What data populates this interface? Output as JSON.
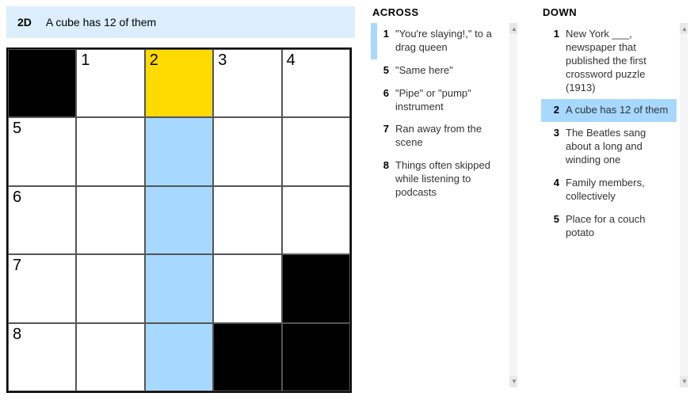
{
  "clue_bar": {
    "number": "2D",
    "text": "A cube has 12 of them"
  },
  "grid": {
    "rows": 5,
    "cols": 5,
    "cells": [
      {
        "r": 0,
        "c": 0,
        "black": true
      },
      {
        "r": 0,
        "c": 1,
        "num": "1"
      },
      {
        "r": 0,
        "c": 2,
        "num": "2",
        "selected": true
      },
      {
        "r": 0,
        "c": 3,
        "num": "3"
      },
      {
        "r": 0,
        "c": 4,
        "num": "4"
      },
      {
        "r": 1,
        "c": 0,
        "num": "5"
      },
      {
        "r": 1,
        "c": 1
      },
      {
        "r": 1,
        "c": 2,
        "highlight": true
      },
      {
        "r": 1,
        "c": 3
      },
      {
        "r": 1,
        "c": 4
      },
      {
        "r": 2,
        "c": 0,
        "num": "6"
      },
      {
        "r": 2,
        "c": 1
      },
      {
        "r": 2,
        "c": 2,
        "highlight": true
      },
      {
        "r": 2,
        "c": 3
      },
      {
        "r": 2,
        "c": 4
      },
      {
        "r": 3,
        "c": 0,
        "num": "7"
      },
      {
        "r": 3,
        "c": 1
      },
      {
        "r": 3,
        "c": 2,
        "highlight": true
      },
      {
        "r": 3,
        "c": 3
      },
      {
        "r": 3,
        "c": 4,
        "black": true
      },
      {
        "r": 4,
        "c": 0,
        "num": "8"
      },
      {
        "r": 4,
        "c": 1
      },
      {
        "r": 4,
        "c": 2,
        "highlight": true
      },
      {
        "r": 4,
        "c": 3,
        "black": true
      },
      {
        "r": 4,
        "c": 4,
        "black": true
      }
    ]
  },
  "across": {
    "heading": "ACROSS",
    "clues": [
      {
        "num": "1",
        "text": "\"You're slaying!,\" to a drag queen",
        "active": true
      },
      {
        "num": "5",
        "text": "\"Same here\""
      },
      {
        "num": "6",
        "text": "\"Pipe\" or \"pump\" instrument"
      },
      {
        "num": "7",
        "text": "Ran away from the scene"
      },
      {
        "num": "8",
        "text": "Things often skipped while listening to podcasts"
      }
    ]
  },
  "down": {
    "heading": "DOWN",
    "clues": [
      {
        "num": "1",
        "text": "New York ___, newspaper that published the first crossword puzzle (1913)"
      },
      {
        "num": "2",
        "text": "A cube has 12 of them",
        "active": true
      },
      {
        "num": "3",
        "text": "The Beatles sang about a long and winding one"
      },
      {
        "num": "4",
        "text": "Family members, collectively"
      },
      {
        "num": "5",
        "text": "Place for a couch potato"
      }
    ]
  }
}
